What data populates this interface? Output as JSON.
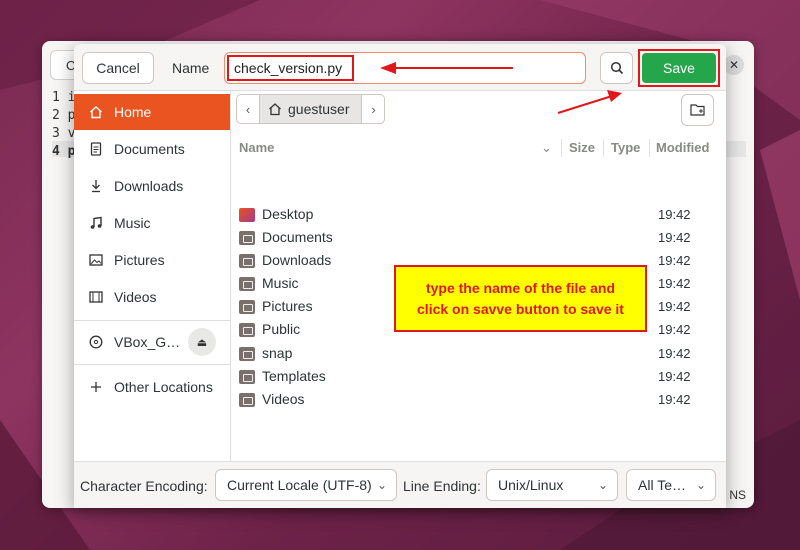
{
  "background_window": {
    "button_label": "O",
    "lines": [
      {
        "num": "1",
        "text": "i"
      },
      {
        "num": "2",
        "text": "p"
      },
      {
        "num": "3",
        "text": "v"
      },
      {
        "num": "4",
        "text": "p"
      }
    ],
    "status_text": "NS"
  },
  "header": {
    "cancel_label": "Cancel",
    "name_label": "Name",
    "name_value": "check_version.py",
    "save_label": "Save"
  },
  "sidebar": {
    "items": [
      {
        "label": "Home"
      },
      {
        "label": "Documents"
      },
      {
        "label": "Downloads"
      },
      {
        "label": "Music"
      },
      {
        "label": "Pictures"
      },
      {
        "label": "Videos"
      }
    ],
    "device_label": "VBox_G…",
    "other_locations_label": "Other Locations"
  },
  "pathbar": {
    "crumb_label": "guestuser"
  },
  "file_list": {
    "columns": {
      "name": "Name",
      "size": "Size",
      "type": "Type",
      "modified": "Modified"
    },
    "rows": [
      {
        "name": "Desktop",
        "modified": "19:42",
        "icon": "desktop-folder-icon"
      },
      {
        "name": "Documents",
        "modified": "19:42",
        "icon": "documents-folder-icon"
      },
      {
        "name": "Downloads",
        "modified": "19:42",
        "icon": "downloads-folder-icon"
      },
      {
        "name": "Music",
        "modified": "19:42",
        "icon": "music-folder-icon"
      },
      {
        "name": "Pictures",
        "modified": "19:42",
        "icon": "pictures-folder-icon"
      },
      {
        "name": "Public",
        "modified": "19:42",
        "icon": "public-folder-icon"
      },
      {
        "name": "snap",
        "modified": "19:42",
        "icon": "folder-icon"
      },
      {
        "name": "Templates",
        "modified": "19:42",
        "icon": "templates-folder-icon"
      },
      {
        "name": "Videos",
        "modified": "19:42",
        "icon": "videos-folder-icon"
      }
    ]
  },
  "footer": {
    "encoding_label": "Character Encoding:",
    "encoding_value": "Current Locale (UTF-8)",
    "line_ending_label": "Line Ending:",
    "line_ending_value": "Unix/Linux",
    "filter_value": "All Te…"
  },
  "annotation": {
    "line1": "type the name of the file and",
    "line2": "click on savve button to save it"
  },
  "colors": {
    "accent": "#e95420",
    "save_green": "#26a64b",
    "annotation_red": "#e0181b",
    "annotation_yellow": "#ffff00"
  }
}
